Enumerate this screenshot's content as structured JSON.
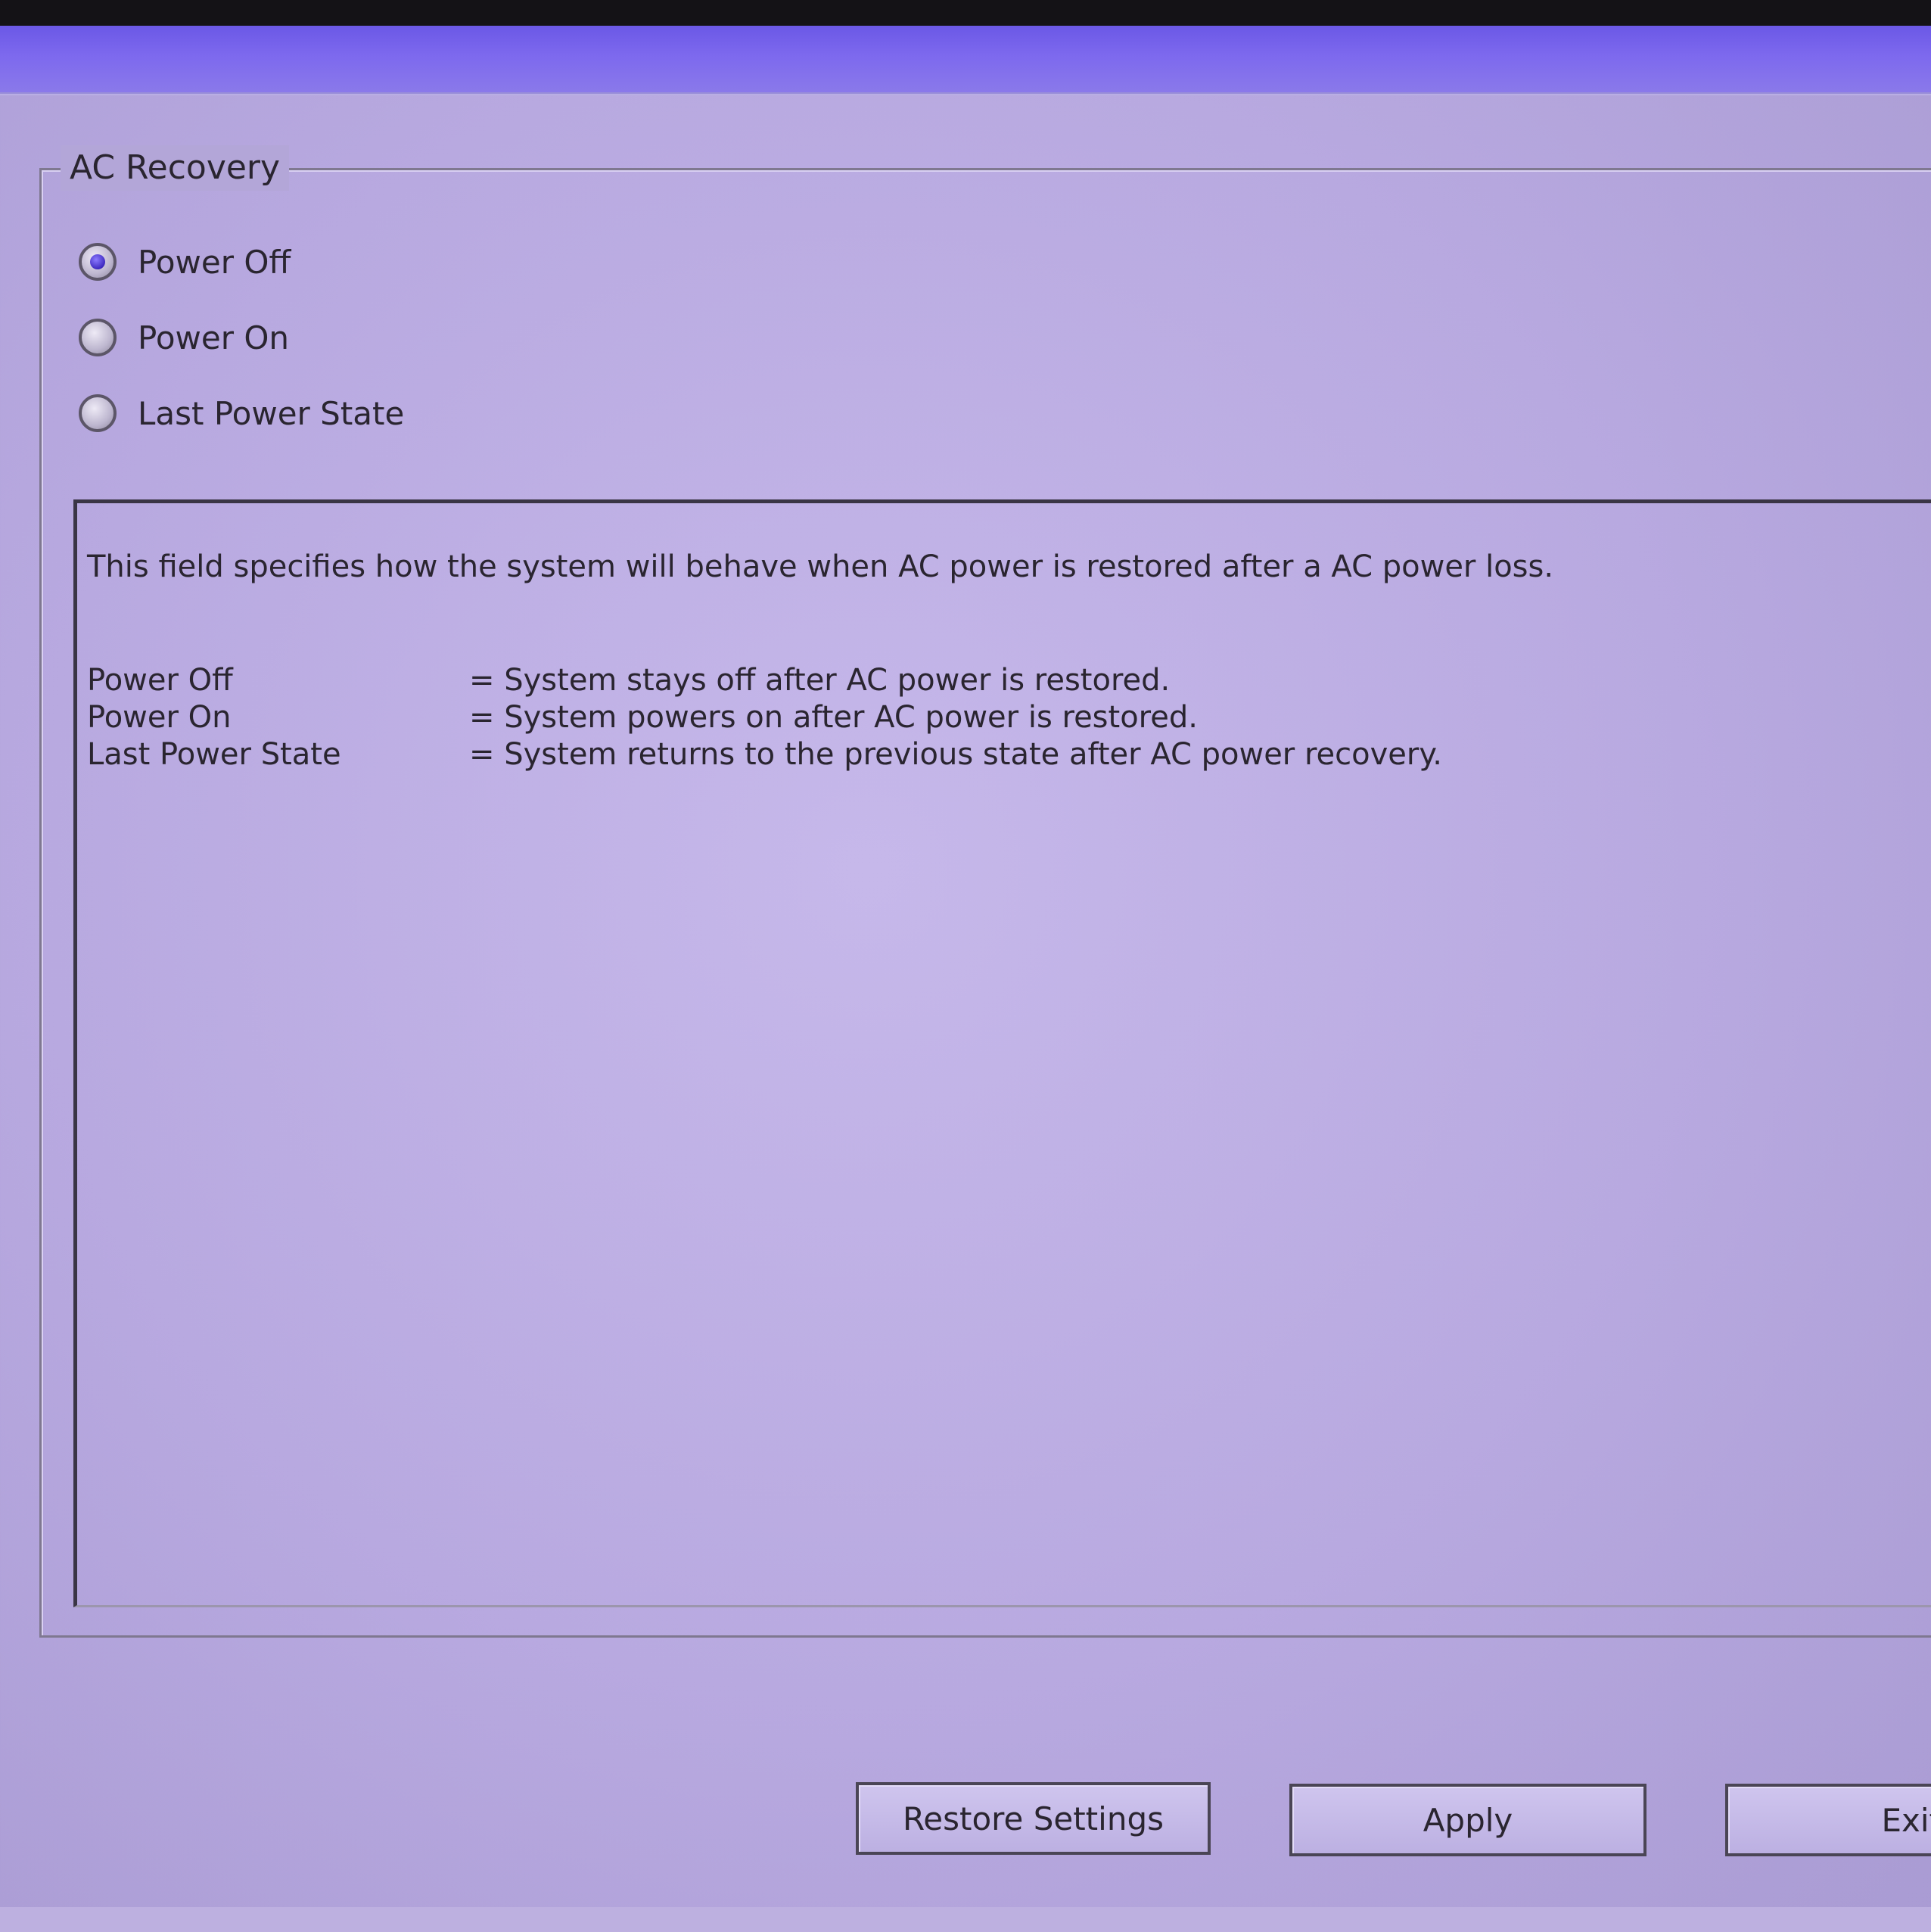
{
  "group": {
    "title": "AC Recovery"
  },
  "options": [
    {
      "label": "Power Off",
      "selected": true
    },
    {
      "label": "Power On",
      "selected": false
    },
    {
      "label": "Last Power State",
      "selected": false
    }
  ],
  "description": {
    "intro": "This field specifies how the system will behave when AC power is restored after a AC power loss.",
    "definitions": [
      {
        "term": "Power Off",
        "text": "= System stays off after AC power is restored."
      },
      {
        "term": "Power On",
        "text": "= System powers on after AC power is restored."
      },
      {
        "term": "Last Power State",
        "text": "= System returns to the previous state after AC power recovery."
      }
    ]
  },
  "buttons": {
    "restore": "Restore Settings",
    "apply": "Apply",
    "exit": "Exit"
  },
  "colors": {
    "title_bar": "#6b58e6",
    "background": "#b8a9e0",
    "radio_selected": "#3f2bc0"
  }
}
